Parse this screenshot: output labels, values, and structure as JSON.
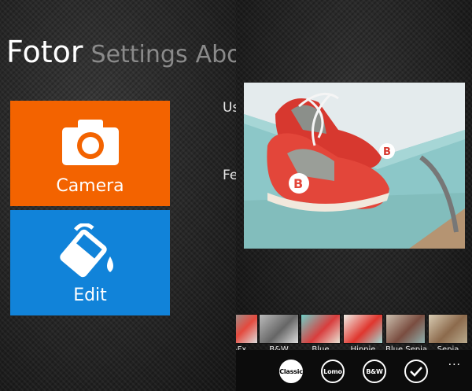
{
  "header": {
    "app_title": "Fotor",
    "tabs": [
      "Settings",
      "Abo"
    ]
  },
  "tiles": [
    {
      "label": "Camera",
      "icon": "camera-icon",
      "color": "#f36300"
    },
    {
      "label": "Edit",
      "icon": "paint-bucket-icon",
      "color": "#1183d9"
    }
  ],
  "peek_text": [
    "Us",
    "Fe"
  ],
  "filters": [
    {
      "label": "o-Fx"
    },
    {
      "label": "B&W"
    },
    {
      "label": "Blue"
    },
    {
      "label": "Hippie"
    },
    {
      "label": "Blue Sepia"
    },
    {
      "label": "Sepia"
    }
  ],
  "appbar": {
    "buttons": [
      "Classic",
      "Lomo",
      "B&W"
    ],
    "selected": "Classic",
    "confirm_icon": "checkmark-icon",
    "more": "..."
  }
}
